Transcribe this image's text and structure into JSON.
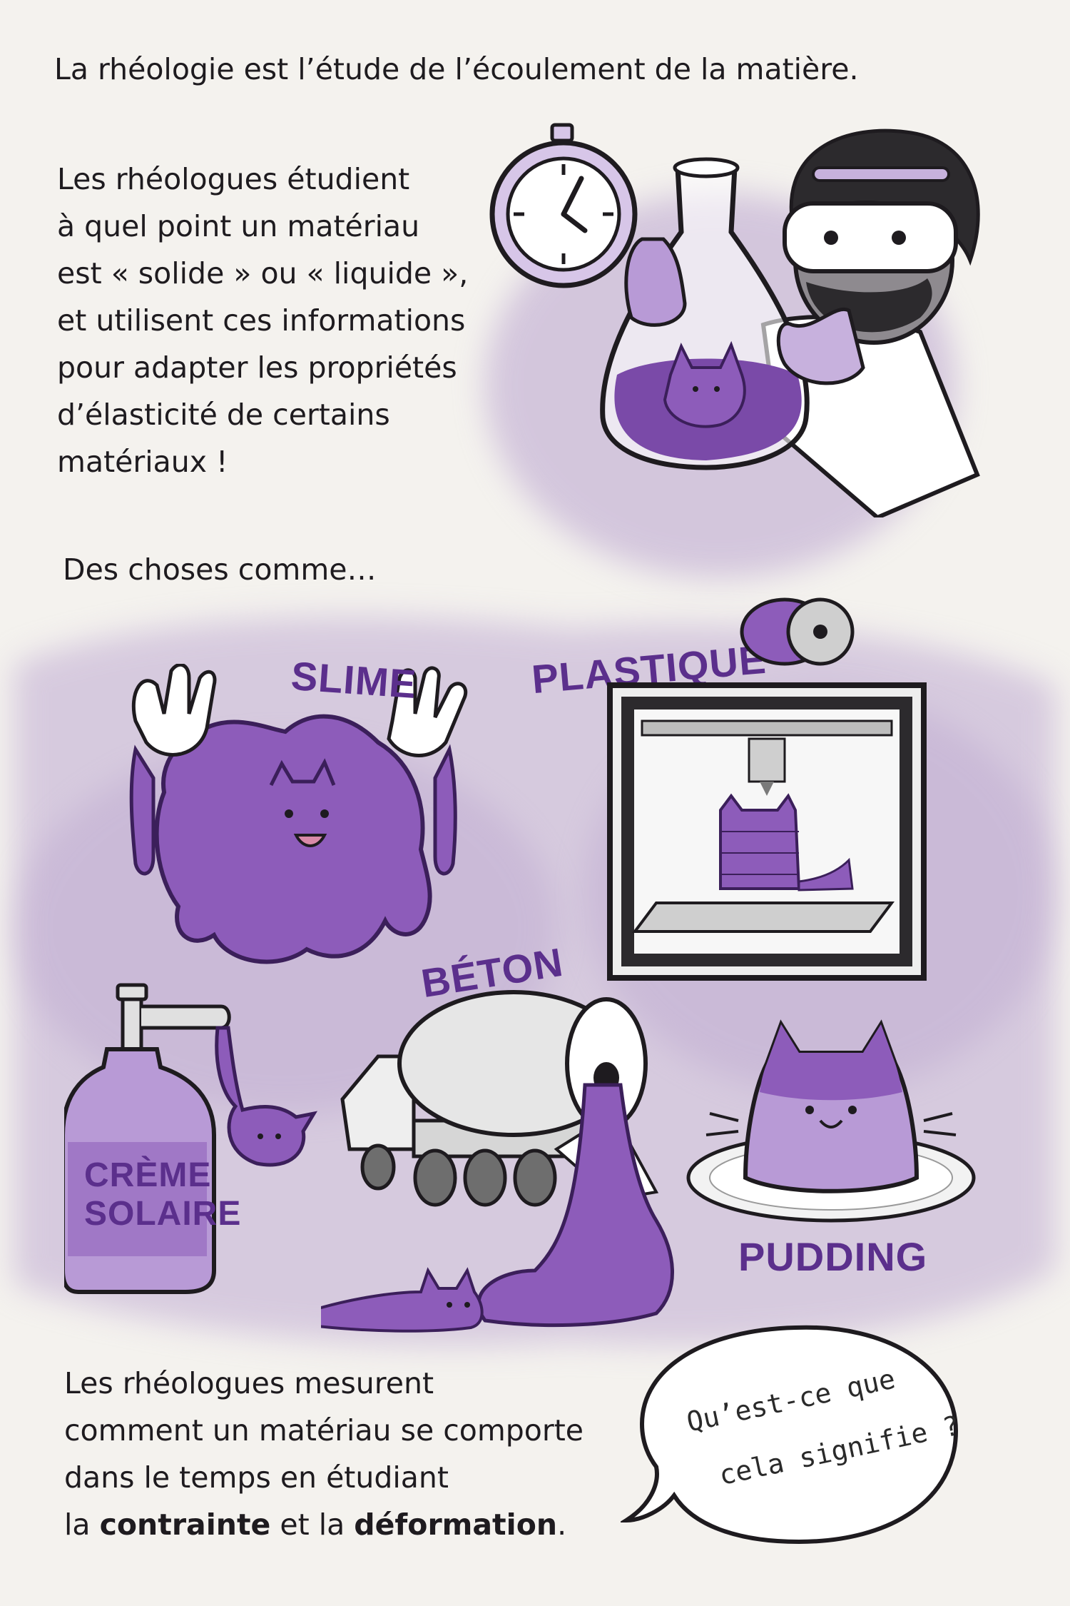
{
  "intro": "La rhéologie est l’étude de l’écoulement de la matière.",
  "paragraph1": [
    "Les rhéologues étudient",
    "à quel point un matériau",
    "est « solide » ou « liquide »,",
    "et utilisent ces informations",
    "pour adapter les propriétés",
    "d’élasticité de certains",
    "matériaux !"
  ],
  "things_like": "Des choses comme…",
  "labels": {
    "slime": "SLIME",
    "plastique": "PLASTIQUE",
    "beton": "BÉTON",
    "creme_line1": "CRÈME",
    "creme_line2": "SOLAIRE",
    "pudding": "PUDDING"
  },
  "paragraph2": {
    "line1": "Les rhéologues mesurent",
    "line2": "comment un matériau se comporte",
    "line3": "dans le temps en étudiant",
    "line4_a": "la ",
    "line4_b": "contrainte",
    "line4_c": " et la ",
    "line4_d": "déformation",
    "line4_e": "."
  },
  "speech_bubble": {
    "line1": "Qu’est-ce que",
    "line2": "cela signifie ?"
  },
  "colors": {
    "purple": "#7a4aa8",
    "purple_dark": "#5b2f8c",
    "purple_light": "#c7b1dd",
    "wash": "#b9a3cf",
    "paper": "#f4f2ee",
    "ink": "#1e1b1f"
  }
}
